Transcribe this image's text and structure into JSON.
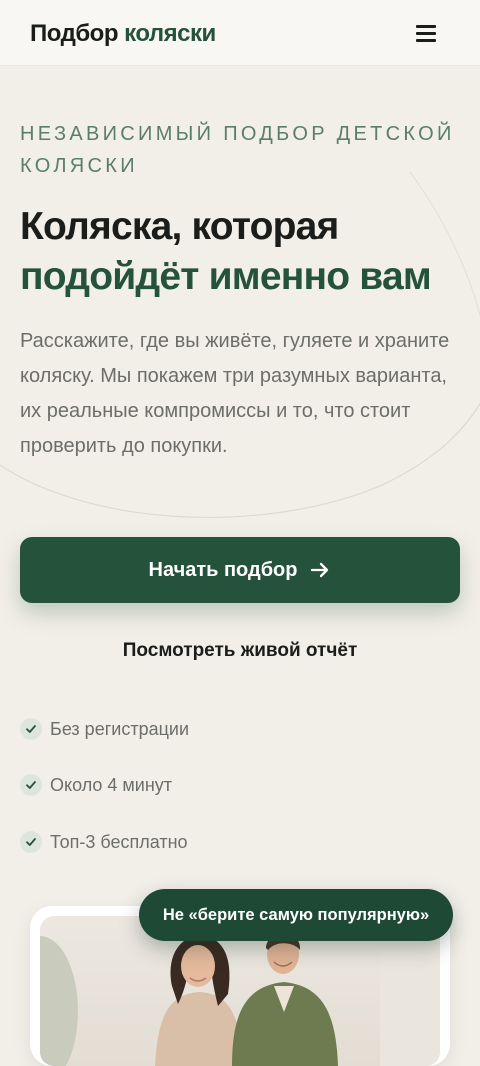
{
  "header": {
    "brand_part1": "Подбор",
    "brand_part2": "коляски",
    "menu_icon": "hamburger-menu-icon"
  },
  "hero": {
    "eyebrow": "НЕЗАВИСИМЫЙ ПОДБОР ДЕТСКОЙ КОЛЯСКИ",
    "title_line1": "Коляска, которая",
    "title_line2": "подойдёт именно вам",
    "lead": "Расскажите, где вы живёте, гуляете и храните коляску. Мы покажем три разумных варианта, их реальные компромиссы и то, что стоит проверить до покупки.",
    "cta_label": "Начать подбор",
    "cta_icon": "arrow-right-icon",
    "secondary_label": "Посмотреть живой отчёт"
  },
  "features": [
    {
      "label": "Без регистрации",
      "icon": "check-icon"
    },
    {
      "label": "Около 4 минут",
      "icon": "check-icon"
    },
    {
      "label": "Топ-3 бесплатно",
      "icon": "check-icon"
    }
  ],
  "card": {
    "badge": "Не «берите самую популярную»"
  },
  "colors": {
    "accent": "#24523a",
    "background": "#f2efe8",
    "eyebrow": "#5b7d6a",
    "muted_text": "#6c6e69"
  }
}
